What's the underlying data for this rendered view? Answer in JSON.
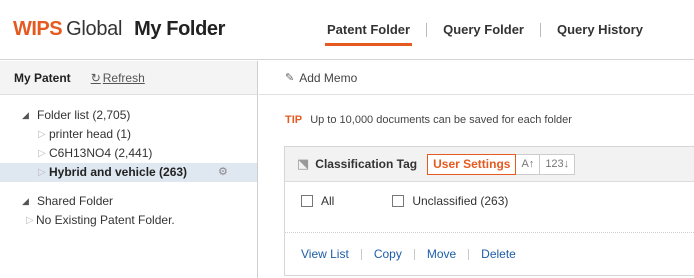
{
  "header": {
    "logo_brand": "WIPS",
    "logo_suffix": "Global",
    "page_title": "My Folder",
    "tabs": [
      {
        "label": "Patent Folder",
        "active": true
      },
      {
        "label": "Query Folder",
        "active": false
      },
      {
        "label": "Query History",
        "active": false
      }
    ]
  },
  "sidebar": {
    "title": "My Patent",
    "refresh_label": "Refresh",
    "folder_list_label": "Folder list (2,705)",
    "folders": [
      {
        "label": "printer head  (1)",
        "selected": false
      },
      {
        "label": "C6H13NO4  (2,441)",
        "selected": false
      },
      {
        "label": "Hybrid and vehicle  (263)",
        "selected": true
      }
    ],
    "shared_folder_label": "Shared Folder",
    "shared_empty_label": "No Existing Patent Folder."
  },
  "main": {
    "add_memo_label": "Add Memo",
    "tip_tag": "TIP",
    "tip_text": "Up to 10,000 documents can be saved for each folder",
    "panel": {
      "title": "Classification Tag",
      "user_settings_label": "User Settings",
      "sort_alpha_label": "A↑",
      "sort_num_label": "123↓",
      "check_all_label": "All",
      "check_unclassified_label": "Unclassified (263)"
    },
    "actions": [
      "View List",
      "Copy",
      "Move",
      "Delete"
    ]
  },
  "colors": {
    "accent": "#e55a20",
    "link": "#1c5ea8",
    "selected_row": "#dfe7f1"
  },
  "icons": {
    "refresh": "refresh-icon",
    "pencil": "pencil-icon",
    "tag": "tag-icon",
    "gear": "gear-icon"
  }
}
